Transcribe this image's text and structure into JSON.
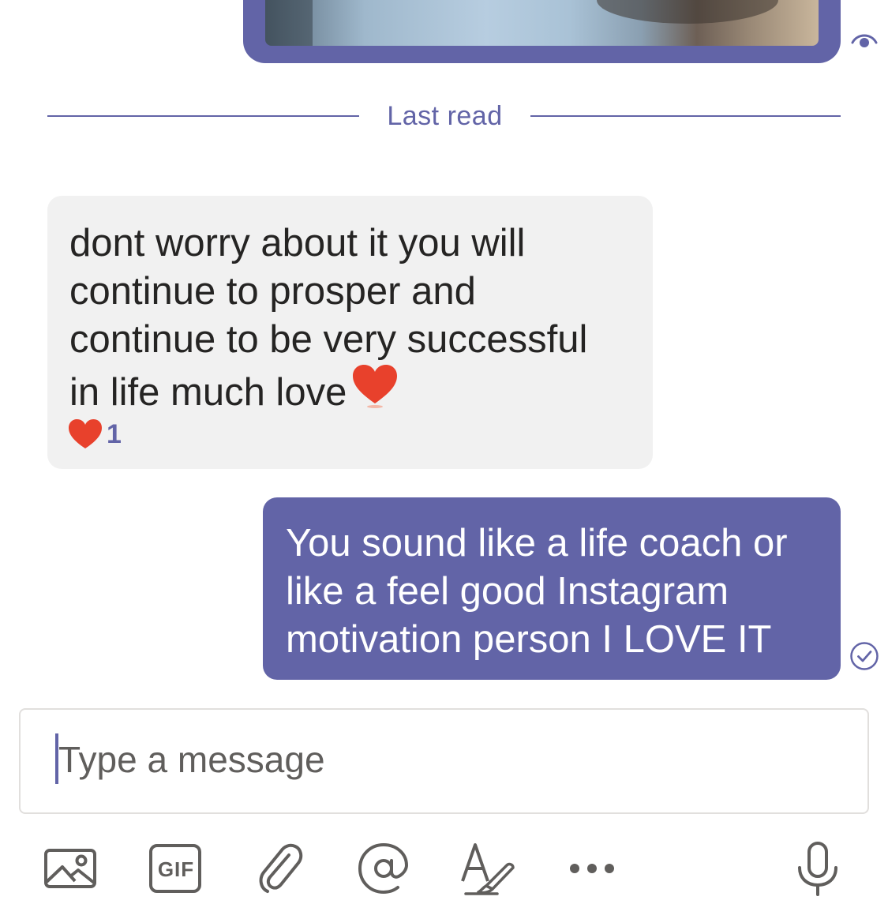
{
  "divider": {
    "label": "Last read"
  },
  "incoming": {
    "lines": [
      "dont worry about it you will",
      "continue to prosper and",
      "continue to be very successful",
      "in life much love"
    ],
    "emoji": "heart-emoji",
    "reaction": {
      "icon": "heart-icon",
      "count": "1"
    }
  },
  "outgoing": {
    "lines": [
      "You sound like a life coach or",
      "like a feel good Instagram",
      "motivation person I LOVE IT"
    ],
    "status_icon": "sent-check-icon"
  },
  "compose": {
    "placeholder": "Type a message"
  },
  "toolbar": {
    "gif_label": "GIF",
    "items": [
      "image-icon",
      "gif-icon",
      "attach-icon",
      "mention-icon",
      "format-icon",
      "more-icon",
      "microphone-icon"
    ]
  },
  "colors": {
    "accent": "#6264a7",
    "incoming_bg": "#f1f1f1",
    "heart": "#e8412c",
    "icon_gray": "#605e5c"
  }
}
